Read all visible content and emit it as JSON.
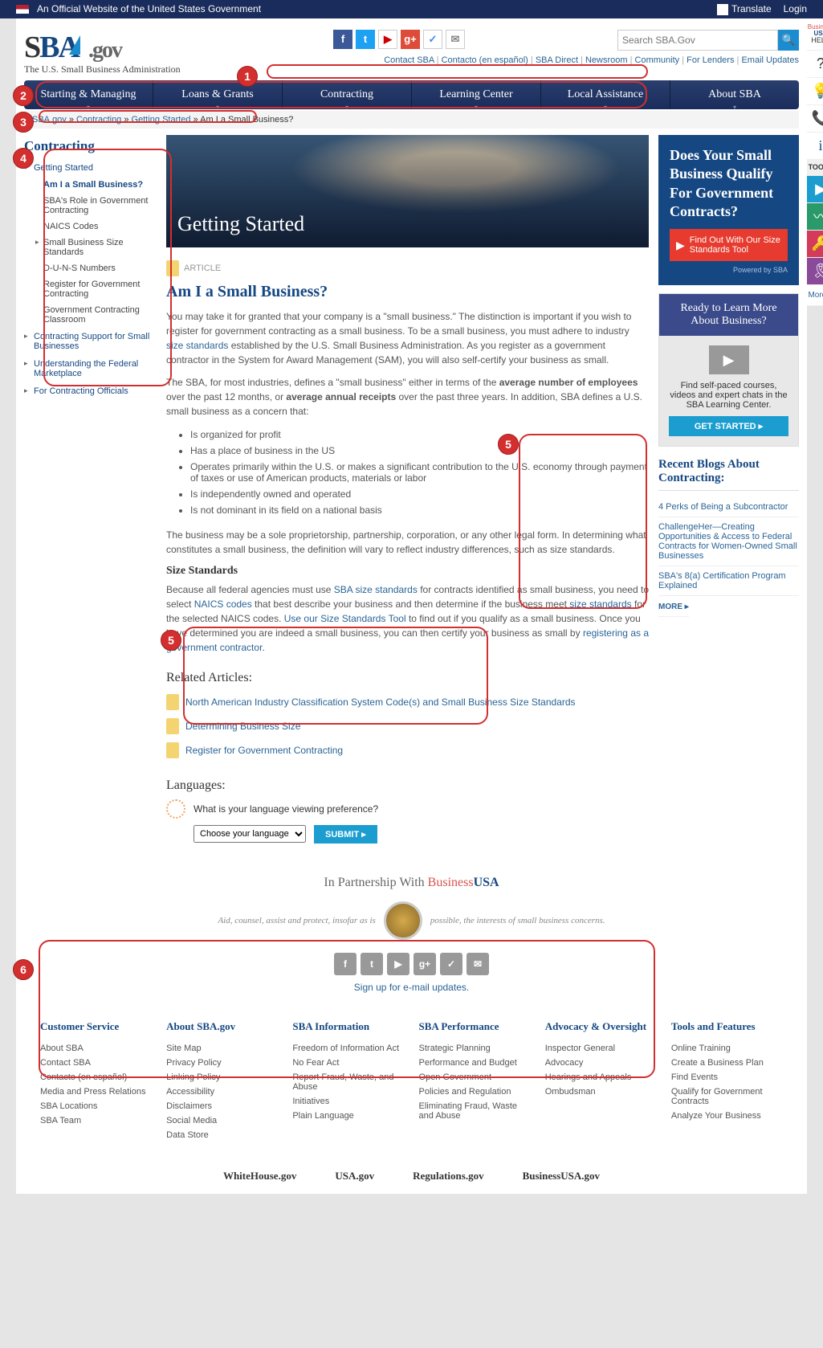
{
  "gov": {
    "text": "An Official Website of the United States Government",
    "translate": "Translate",
    "login": "Login"
  },
  "logo": {
    "s": "S",
    "b": "B",
    "a": "A",
    "gov": ".gov",
    "sub": "The U.S. Small Business Administration"
  },
  "search": {
    "placeholder": "Search SBA.Gov"
  },
  "toplinks": [
    "Contact SBA",
    "Contacto (en español)",
    "SBA Direct",
    "Newsroom",
    "Community",
    "For Lenders",
    "Email Updates"
  ],
  "nav": [
    "Starting & Managing",
    "Loans & Grants",
    "Contracting",
    "Learning Center",
    "Local Assistance",
    "About SBA"
  ],
  "crumbs": [
    "SBA.gov",
    "Contracting",
    "Getting Started",
    "Am I a Small Business?"
  ],
  "left": {
    "title": "Contracting",
    "g1": {
      "label": "Getting Started",
      "items": [
        "Am I a Small Business?",
        "SBA's Role in Government Contracting",
        "NAICS Codes",
        "Small Business Size Standards",
        "D-U-N-S Numbers",
        "Register for Government Contracting",
        "Government Contracting Classroom"
      ]
    },
    "g2": "Contracting Support for Small Businesses",
    "g3": "Understanding the Federal Marketplace",
    "g4": "For Contracting Officials"
  },
  "hero": "Getting Started",
  "artlabel": "ARTICLE",
  "art": {
    "title": "Am I a Small Business?",
    "p1a": "You may take it for granted that your company is a \"small business.\" The distinction is important if you wish to register for government contracting as a small business. To be a small business, you must adhere to industry ",
    "p1l": "size standards",
    "p1b": " established by the U.S. Small Business Administration. As you register as a government contractor in the System for Award Management (SAM), you will also self-certify your business as small.",
    "p2a": "The SBA, for most industries, defines a \"small business\" either in terms of the ",
    "p2b": "average number of employees",
    "p2c": " over the past 12 months, or ",
    "p2d": "average annual receipts",
    "p2e": " over the past three years. In addition, SBA defines a U.S. small business as a concern that:",
    "li": [
      "Is organized for profit",
      "Has a place of business in the US",
      "Operates primarily within the U.S. or makes a significant contribution to the U.S. economy through payment of taxes or use of American products, materials or labor",
      "Is independently owned and operated",
      "Is not dominant in its field on a national basis"
    ],
    "p3": "The business may be a sole proprietorship, partnership, corporation, or any other legal form. In determining what constitutes a small business, the definition will vary to reflect industry differences, such as size standards.",
    "h3": "Size Standards",
    "p4a": "Because all federal agencies must use ",
    "p4l1": "SBA size standards",
    "p4b": " for contracts identified as small business, you need to select ",
    "p4l2": "NAICS codes",
    "p4c": " that best describe your business and then determine if the business meet ",
    "p4l3": "size standards",
    "p4d": " for the selected NAICS codes. ",
    "p4l4": "Use our Size Standards Tool",
    "p4e": " to find out if you qualify as a small business. Once you have determined you are indeed a small business, you can then certify your business as small by ",
    "p4l5": "registering as a government contractor",
    "p4f": "."
  },
  "rel": {
    "h": "Related Articles:",
    "items": [
      "North American Industry Classification System Code(s) and Small Business Size Standards",
      "Determining Business Size",
      "Register for Government Contracting"
    ]
  },
  "lang": {
    "h": "Languages:",
    "q": "What is your language viewing preference?",
    "sel": "Choose your language …",
    "btn": "SUBMIT"
  },
  "promo1": {
    "h": "Does Your Small Business Qualify For Government Contracts?",
    "btn": "Find Out With Our Size Standards Tool",
    "pb": "Powered by SBA"
  },
  "promo2": {
    "h": "Ready to Learn More About Business?",
    "t": "Find self-paced courses, videos and expert chats in the SBA Learning Center.",
    "btn": "GET STARTED   ▸"
  },
  "blogs": {
    "h": "Recent Blogs About Contracting:",
    "items": [
      "4 Perks of Being a Subcontractor",
      "ChallengeHer—Creating Opportunities & Access to Federal Contracts for Women-Owned Small Businesses",
      "SBA's 8(a) Certification Program Explained"
    ],
    "more": "MORE  ▸"
  },
  "partner": {
    "pre": "In Partnership With ",
    "b": "Business",
    "u": "USA"
  },
  "motto": {
    "a": "Aid, counsel, assist and protect, insofar as is",
    "b": "possible, the interests of small business concerns."
  },
  "signup": "Sign up for e-mail updates.",
  "fcols": [
    {
      "h": "Customer Service",
      "l": [
        "About SBA",
        "Contact SBA",
        "Contacto (en español)",
        "Media and Press Relations",
        "SBA Locations",
        "SBA Team"
      ]
    },
    {
      "h": "About SBA.gov",
      "l": [
        "Site Map",
        "Privacy Policy",
        "Linking Policy",
        "Accessibility",
        "Disclaimers",
        "Social Media",
        "Data Store"
      ]
    },
    {
      "h": "SBA Information",
      "l": [
        "Freedom of Information Act",
        "No Fear Act",
        "Report Fraud, Waste, and Abuse",
        "Initiatives",
        "Plain Language"
      ]
    },
    {
      "h": "SBA Performance",
      "l": [
        "Strategic Planning",
        "Performance and Budget",
        "Open Government",
        "Policies and Regulation",
        "Eliminating Fraud, Waste and Abuse"
      ]
    },
    {
      "h": "Advocacy & Oversight",
      "l": [
        "Inspector General",
        "Advocacy",
        "Hearings and Appeals",
        "Ombudsman"
      ]
    },
    {
      "h": "Tools and Features",
      "l": [
        "Online Training",
        "Create a Business Plan",
        "Find Events",
        "Qualify for Government Contracts",
        "Analyze Your Business"
      ]
    }
  ],
  "fbot": [
    "WhiteHouse.gov",
    "USA.gov",
    "Regulations.gov",
    "BusinessUSA.gov"
  ],
  "side": {
    "busa1": "Business",
    "busa2": "USA",
    "help": "HELP",
    "tools": "TOOLS",
    "more": "More..."
  }
}
